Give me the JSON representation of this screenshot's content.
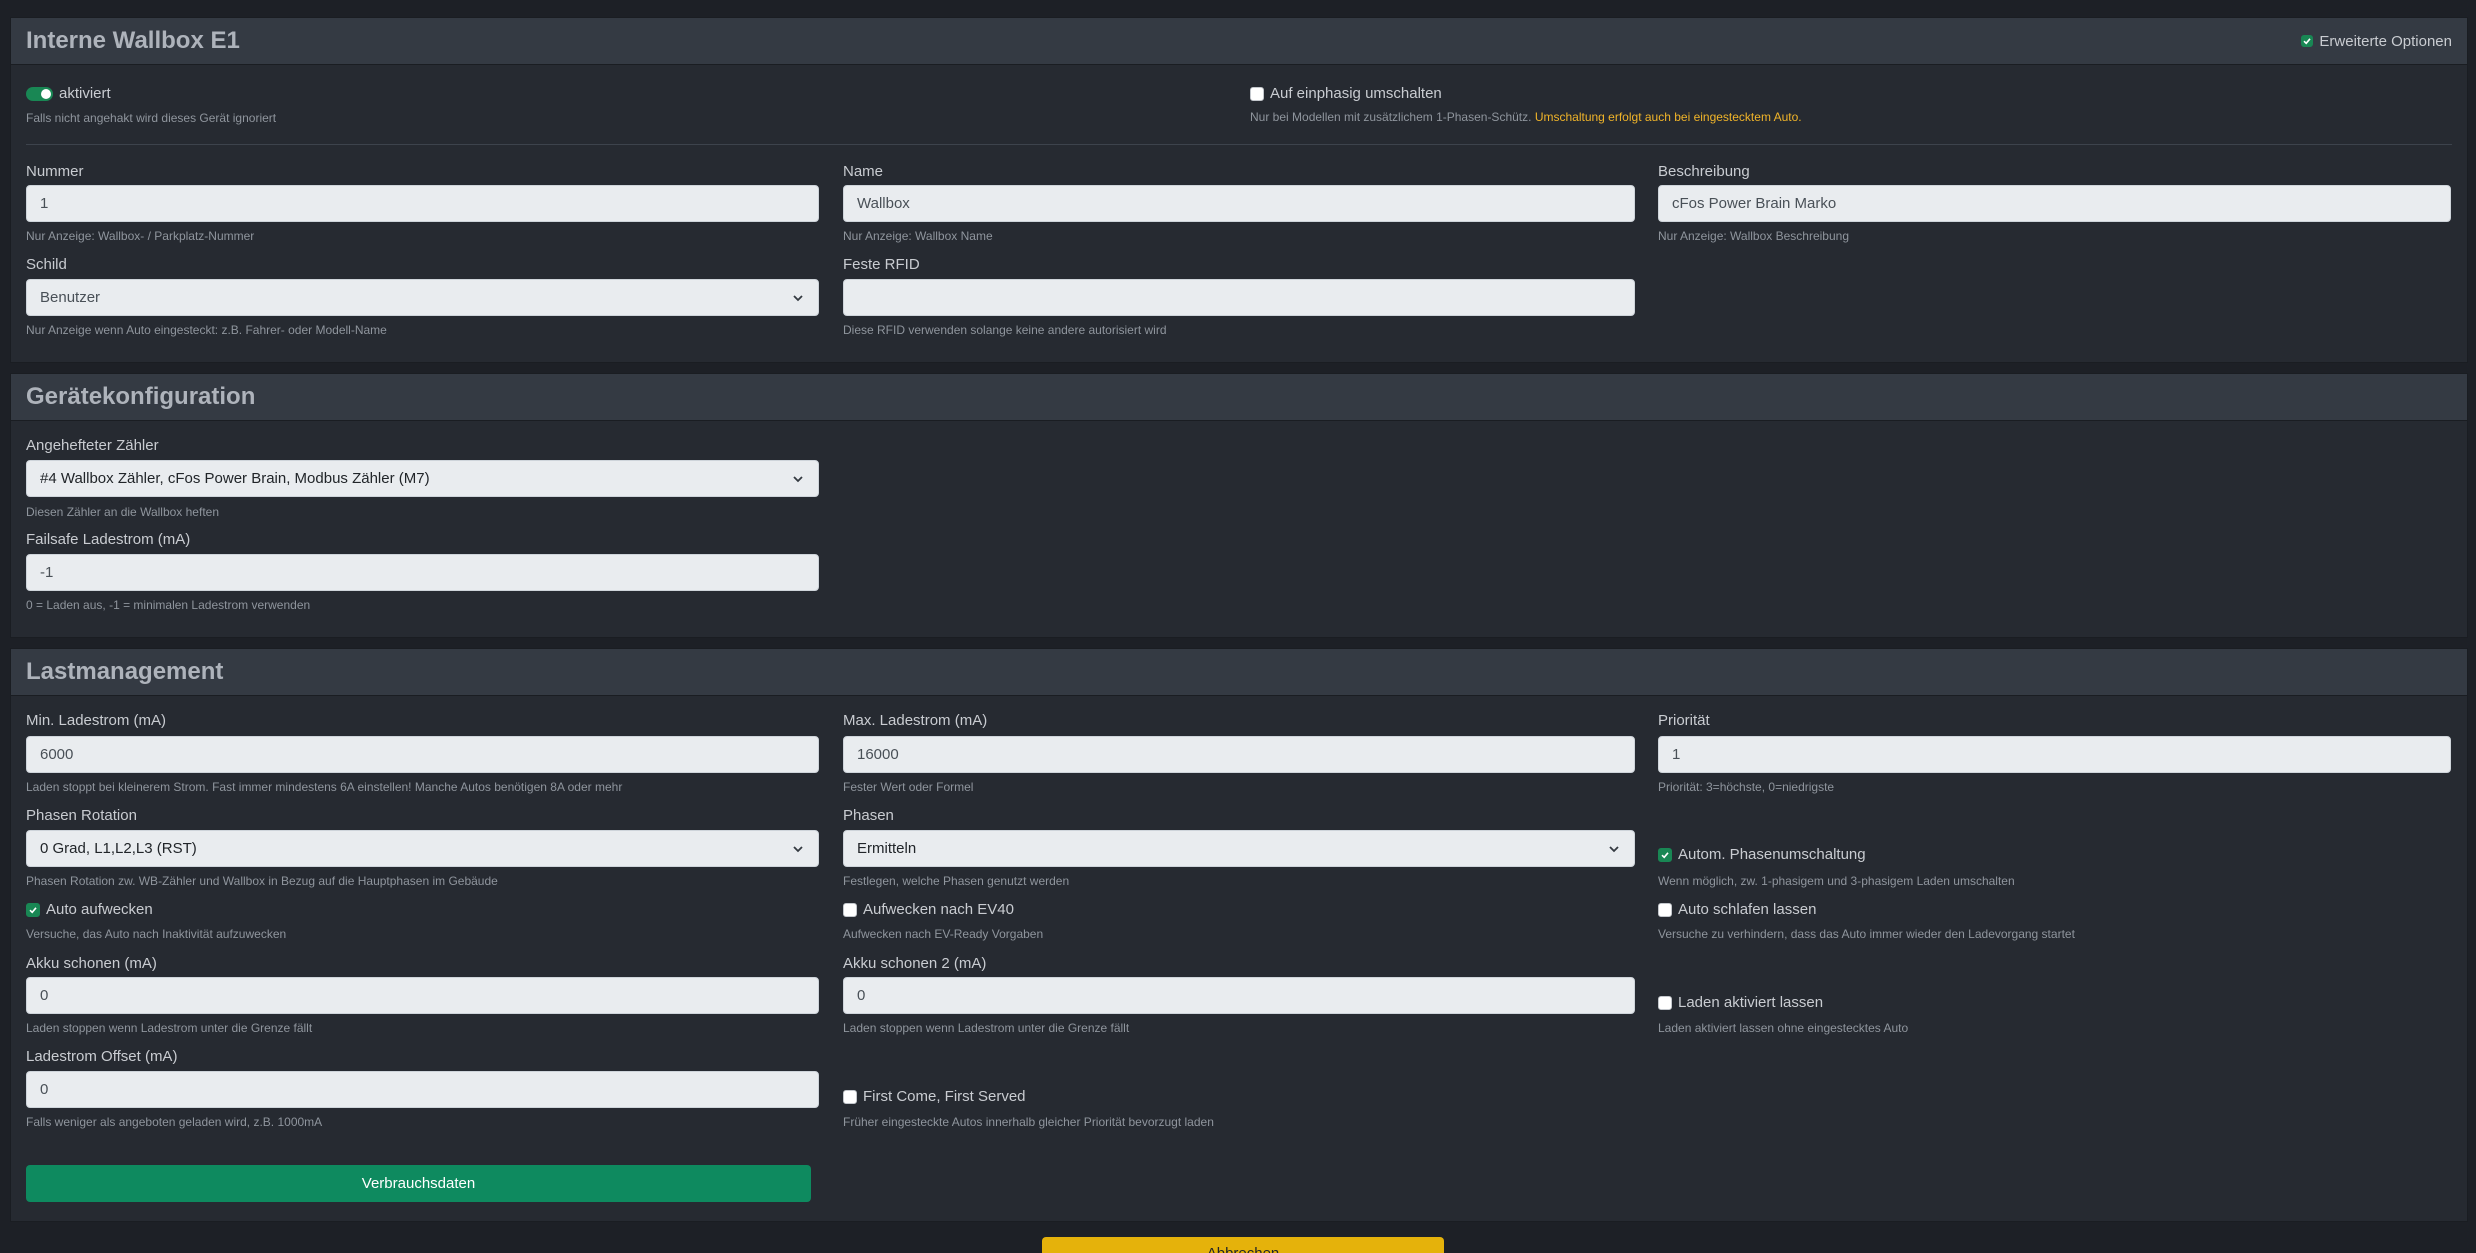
{
  "wallbox": {
    "title": "Interne Wallbox E1",
    "advanced_options_label": "Erweiterte Optionen",
    "enabled_label": "aktiviert",
    "enabled_help": "Falls nicht angehakt wird dieses Gerät ignoriert",
    "single_phase_label": "Auf einphasig umschalten",
    "single_phase_help": "Nur bei Modellen mit zusätzlichem 1-Phasen-Schütz.",
    "single_phase_warning": "Umschaltung erfolgt auch bei eingestecktem Auto.",
    "number_label": "Nummer",
    "number_value": "1",
    "number_help": "Nur Anzeige: Wallbox- / Parkplatz-Nummer",
    "name_label": "Name",
    "name_value": "Wallbox",
    "name_help": "Nur Anzeige: Wallbox Name",
    "description_label": "Beschreibung",
    "description_value": "cFos Power Brain Marko",
    "description_help": "Nur Anzeige: Wallbox Beschreibung",
    "sign_label": "Schild",
    "sign_value": "Benutzer",
    "sign_help": "Nur Anzeige wenn Auto eingesteckt: z.B. Fahrer- oder Modell-Name",
    "rfid_label": "Feste RFID",
    "rfid_value": "",
    "rfid_help": "Diese RFID verwenden solange keine andere autorisiert wird"
  },
  "device": {
    "title": "Gerätekonfiguration",
    "meter_label": "Angehefteter Zähler",
    "meter_value": "#4 Wallbox Zähler, cFos Power Brain, Modbus Zähler (M7)",
    "meter_help": "Diesen Zähler an die Wallbox heften",
    "failsafe_label": "Failsafe Ladestrom (mA)",
    "failsafe_value": "-1",
    "failsafe_help": "0 = Laden aus, -1 = minimalen Ladestrom verwenden"
  },
  "load": {
    "title": "Lastmanagement",
    "min_label": "Min. Ladestrom (mA)",
    "min_value": "6000",
    "min_help": "Laden stoppt bei kleinerem Strom. Fast immer mindestens 6A einstellen! Manche Autos benötigen 8A oder mehr",
    "max_label": "Max. Ladestrom (mA)",
    "max_value": "16000",
    "max_help": "Fester Wert oder Formel",
    "prio_label": "Priorität",
    "prio_value": "1",
    "prio_help": "Priorität: 3=höchste, 0=niedrigste",
    "rotation_label": "Phasen Rotation",
    "rotation_value": "0 Grad, L1,L2,L3 (RST)",
    "rotation_help": "Phasen Rotation zw. WB-Zähler und Wallbox in Bezug auf die Hauptphasen im Gebäude",
    "phases_label": "Phasen",
    "phases_value": "Ermitteln",
    "phases_help": "Festlegen, welche Phasen genutzt werden",
    "auto_phase_label": "Autom. Phasenumschaltung",
    "auto_phase_help": "Wenn möglich, zw. 1-phasigem und 3-phasigem Laden umschalten",
    "wake_label": "Auto aufwecken",
    "wake_help": "Versuche, das Auto nach Inaktivität aufzuwecken",
    "wake_ev40_label": "Aufwecken nach EV40",
    "wake_ev40_help": "Aufwecken nach EV-Ready Vorgaben",
    "sleep_label": "Auto schlafen lassen",
    "sleep_help": "Versuche zu verhindern, dass das Auto immer wieder den Ladevorgang startet",
    "battery_label": "Akku schonen (mA)",
    "battery_value": "0",
    "battery_help": "Laden stoppen wenn Ladestrom unter die Grenze fällt",
    "battery2_label": "Akku schonen 2 (mA)",
    "battery2_value": "0",
    "battery2_help": "Laden stoppen wenn Ladestrom unter die Grenze fällt",
    "keep_label": "Laden aktiviert lassen",
    "keep_help": "Laden aktiviert lassen ohne eingestecktes Auto",
    "offset_label": "Ladestrom Offset (mA)",
    "offset_value": "0",
    "offset_help": "Falls weniger als angeboten geladen wird, z.B. 1000mA",
    "fcfs_label": "First Come, First Served",
    "fcfs_help": "Früher eingesteckte Autos innerhalb gleicher Priorität bevorzugt laden",
    "consumption_button": "Verbrauchsdaten"
  },
  "footer": {
    "bottom_button": "Abbrechen"
  },
  "colors": {
    "accent_green": "#198754",
    "button_green": "#0e8a5f",
    "warning": "#f0b429",
    "button_yellow": "#e5b20b"
  }
}
